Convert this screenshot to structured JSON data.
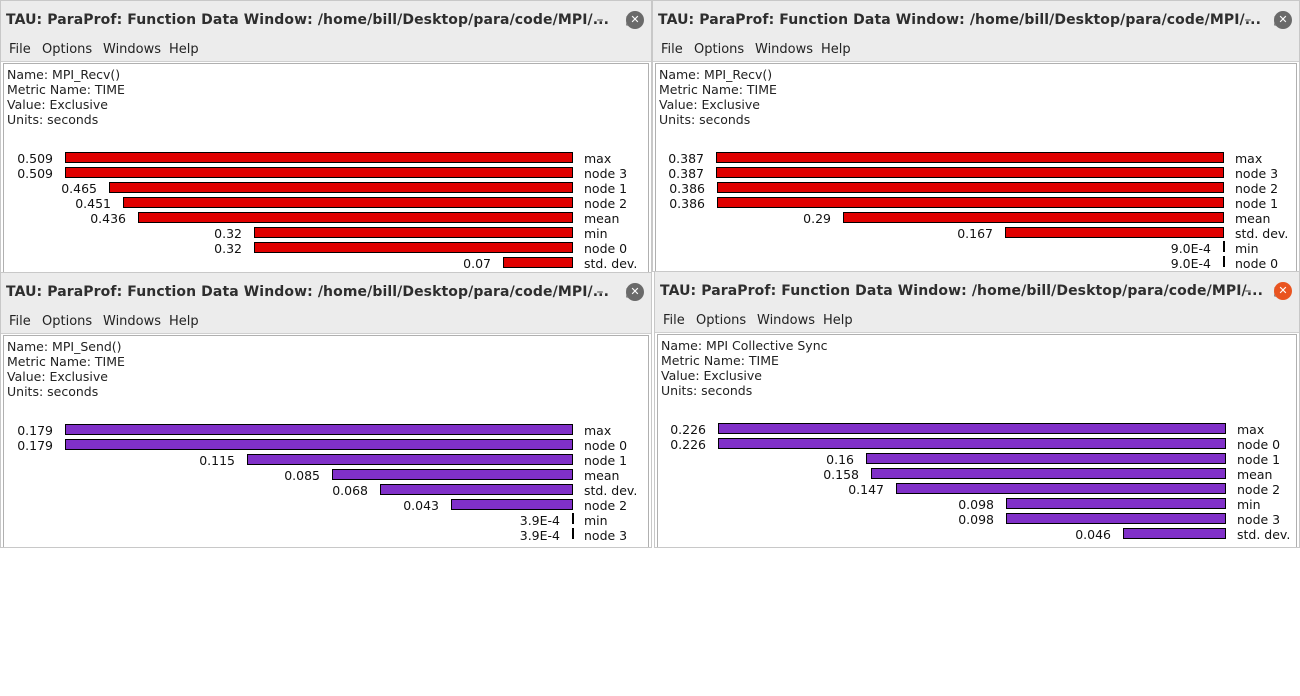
{
  "windows": [
    {
      "id": "w1",
      "title": "TAU: ParaProf: Function Data Window: /home/bill/Desktop/para/code/MPI/...",
      "menu": [
        "File",
        "Options",
        "Windows",
        "Help"
      ],
      "info": {
        "name": "Name: MPI_Recv()",
        "metric": "Metric Name: TIME",
        "value": "Value: Exclusive",
        "units": "Units: seconds"
      },
      "active": false,
      "bar_color": "#e00000",
      "chart_data": {
        "type": "bar",
        "orientation": "horizontal",
        "categories": [
          "max",
          "node 3",
          "node 1",
          "node 2",
          "mean",
          "min",
          "node 0",
          "std. dev."
        ],
        "values": [
          0.509,
          0.509,
          0.465,
          0.451,
          0.436,
          0.32,
          0.32,
          0.07
        ],
        "labels": [
          "0.509",
          "0.509",
          "0.465",
          "0.451",
          "0.436",
          "0.32",
          "0.32",
          "0.07"
        ]
      }
    },
    {
      "id": "w2",
      "title": "TAU: ParaProf: Function Data Window: /home/bill/Desktop/para/code/MPI/...",
      "menu": [
        "File",
        "Options",
        "Windows",
        "Help"
      ],
      "info": {
        "name": "Name: MPI_Recv()",
        "metric": "Metric Name: TIME",
        "value": "Value: Exclusive",
        "units": "Units: seconds"
      },
      "active": false,
      "bar_color": "#e00000",
      "chart_data": {
        "type": "bar",
        "orientation": "horizontal",
        "categories": [
          "max",
          "node 3",
          "node 2",
          "node 1",
          "mean",
          "std. dev.",
          "min",
          "node 0"
        ],
        "values": [
          0.387,
          0.387,
          0.386,
          0.386,
          0.29,
          0.167,
          0.0009,
          0.0009
        ],
        "labels": [
          "0.387",
          "0.387",
          "0.386",
          "0.386",
          "0.29",
          "0.167",
          "9.0E-4",
          "9.0E-4"
        ]
      }
    },
    {
      "id": "w3",
      "title": "TAU: ParaProf: Function Data Window: /home/bill/Desktop/para/code/MPI/...",
      "menu": [
        "File",
        "Options",
        "Windows",
        "Help"
      ],
      "info": {
        "name": "Name: MPI_Send()",
        "metric": "Metric Name: TIME",
        "value": "Value: Exclusive",
        "units": "Units: seconds"
      },
      "active": false,
      "bar_color": "#8030c8",
      "chart_data": {
        "type": "bar",
        "orientation": "horizontal",
        "categories": [
          "max",
          "node 0",
          "node 1",
          "mean",
          "std. dev.",
          "node 2",
          "min",
          "node 3"
        ],
        "values": [
          0.179,
          0.179,
          0.115,
          0.085,
          0.068,
          0.043,
          0.00039,
          0.00039
        ],
        "labels": [
          "0.179",
          "0.179",
          "0.115",
          "0.085",
          "0.068",
          "0.043",
          "3.9E-4",
          "3.9E-4"
        ]
      }
    },
    {
      "id": "w4",
      "title": "TAU: ParaProf: Function Data Window: /home/bill/Desktop/para/code/MPI/...",
      "menu": [
        "File",
        "Options",
        "Windows",
        "Help"
      ],
      "info": {
        "name": "Name: MPI Collective Sync",
        "metric": "Metric Name: TIME",
        "value": "Value: Exclusive",
        "units": "Units: seconds"
      },
      "active": true,
      "bar_color": "#8030c8",
      "chart_data": {
        "type": "bar",
        "orientation": "horizontal",
        "categories": [
          "max",
          "node 0",
          "node 1",
          "mean",
          "node 2",
          "min",
          "node 3",
          "std. dev."
        ],
        "values": [
          0.226,
          0.226,
          0.16,
          0.158,
          0.147,
          0.098,
          0.098,
          0.046
        ],
        "labels": [
          "0.226",
          "0.226",
          "0.16",
          "0.158",
          "0.147",
          "0.098",
          "0.098",
          "0.046"
        ]
      }
    }
  ],
  "window_controls": {
    "minimize": "–",
    "maximize": "□",
    "close": "✕"
  }
}
